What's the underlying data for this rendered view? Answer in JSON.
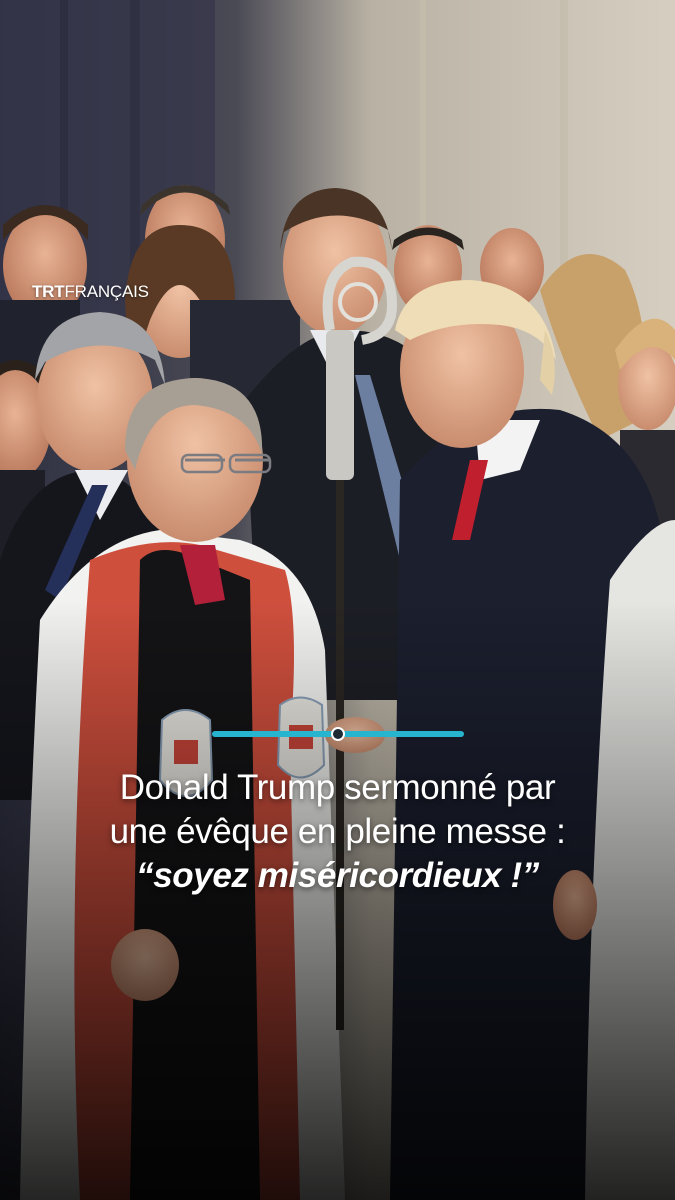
{
  "brand": {
    "logo_bold": "TRT",
    "logo_rest": "FRANÇAIS"
  },
  "slider": {
    "progress": 0.5
  },
  "headline": {
    "line1": "Donald Trump sermonné par",
    "line2": "une évêque en pleine messe :",
    "line3": "“soyez miséricordieux !”"
  },
  "colors": {
    "accent": "#27b4cf",
    "text": "#ffffff",
    "vestment_red": "#c8453a",
    "tie_red": "#c01f2e",
    "coat_navy": "#1b1f2e"
  },
  "icons": {
    "crosier": "bishop-crosier",
    "badge": "episcopal-shield-badge"
  }
}
